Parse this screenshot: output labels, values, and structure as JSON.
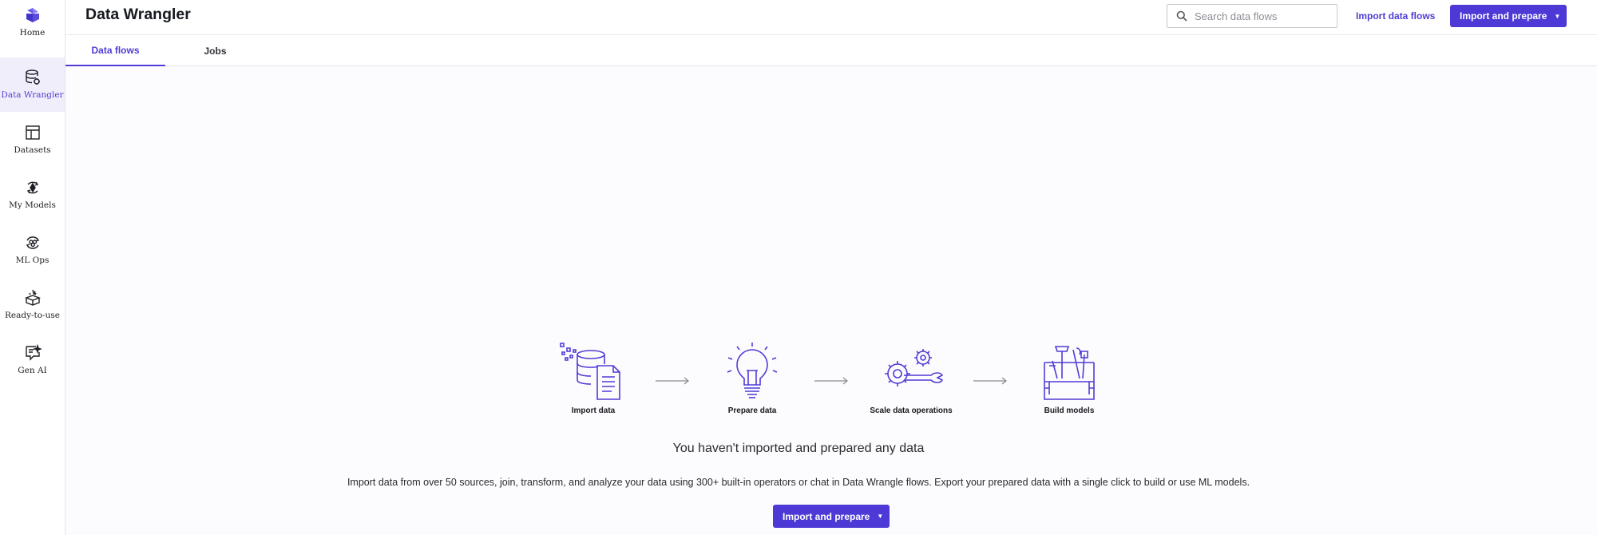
{
  "sidebar": {
    "items": [
      {
        "label": "Home",
        "icon": "home-logo-icon"
      },
      {
        "label": "Data Wrangler",
        "icon": "database-wrench-icon",
        "active": true
      },
      {
        "label": "Datasets",
        "icon": "table-icon"
      },
      {
        "label": "My Models",
        "icon": "model-cycle-icon"
      },
      {
        "label": "ML Ops",
        "icon": "ml-ops-icon"
      },
      {
        "label": "Ready-to-use",
        "icon": "box-spark-icon"
      },
      {
        "label": "Gen AI",
        "icon": "chat-spark-icon"
      }
    ]
  },
  "header": {
    "title": "Data Wrangler",
    "search_placeholder": "Search data flows",
    "import_flows_label": "Import data flows",
    "import_prepare_label": "Import and prepare"
  },
  "tabs": [
    {
      "label": "Data flows",
      "active": true
    },
    {
      "label": "Jobs",
      "active": false
    }
  ],
  "empty_state": {
    "steps": [
      {
        "label": "Import data",
        "icon": "database-document-icon"
      },
      {
        "label": "Prepare data",
        "icon": "lightbulb-icon"
      },
      {
        "label": "Scale data operations",
        "icon": "gears-wrench-icon"
      },
      {
        "label": "Build models",
        "icon": "toolbox-icon"
      }
    ],
    "title": "You haven't imported and prepared any data",
    "description": "Import data from over 50 sources, join, transform, and analyze your data using 300+ built-in operators or chat in Data Wrangle flows. Export your prepared data with a single click to build or use ML models.",
    "cta_label": "Import and prepare"
  },
  "colors": {
    "accent": "#4d3ad6",
    "active_nav_bg": "#f1eefb",
    "illustration": "#4f3dd6"
  }
}
